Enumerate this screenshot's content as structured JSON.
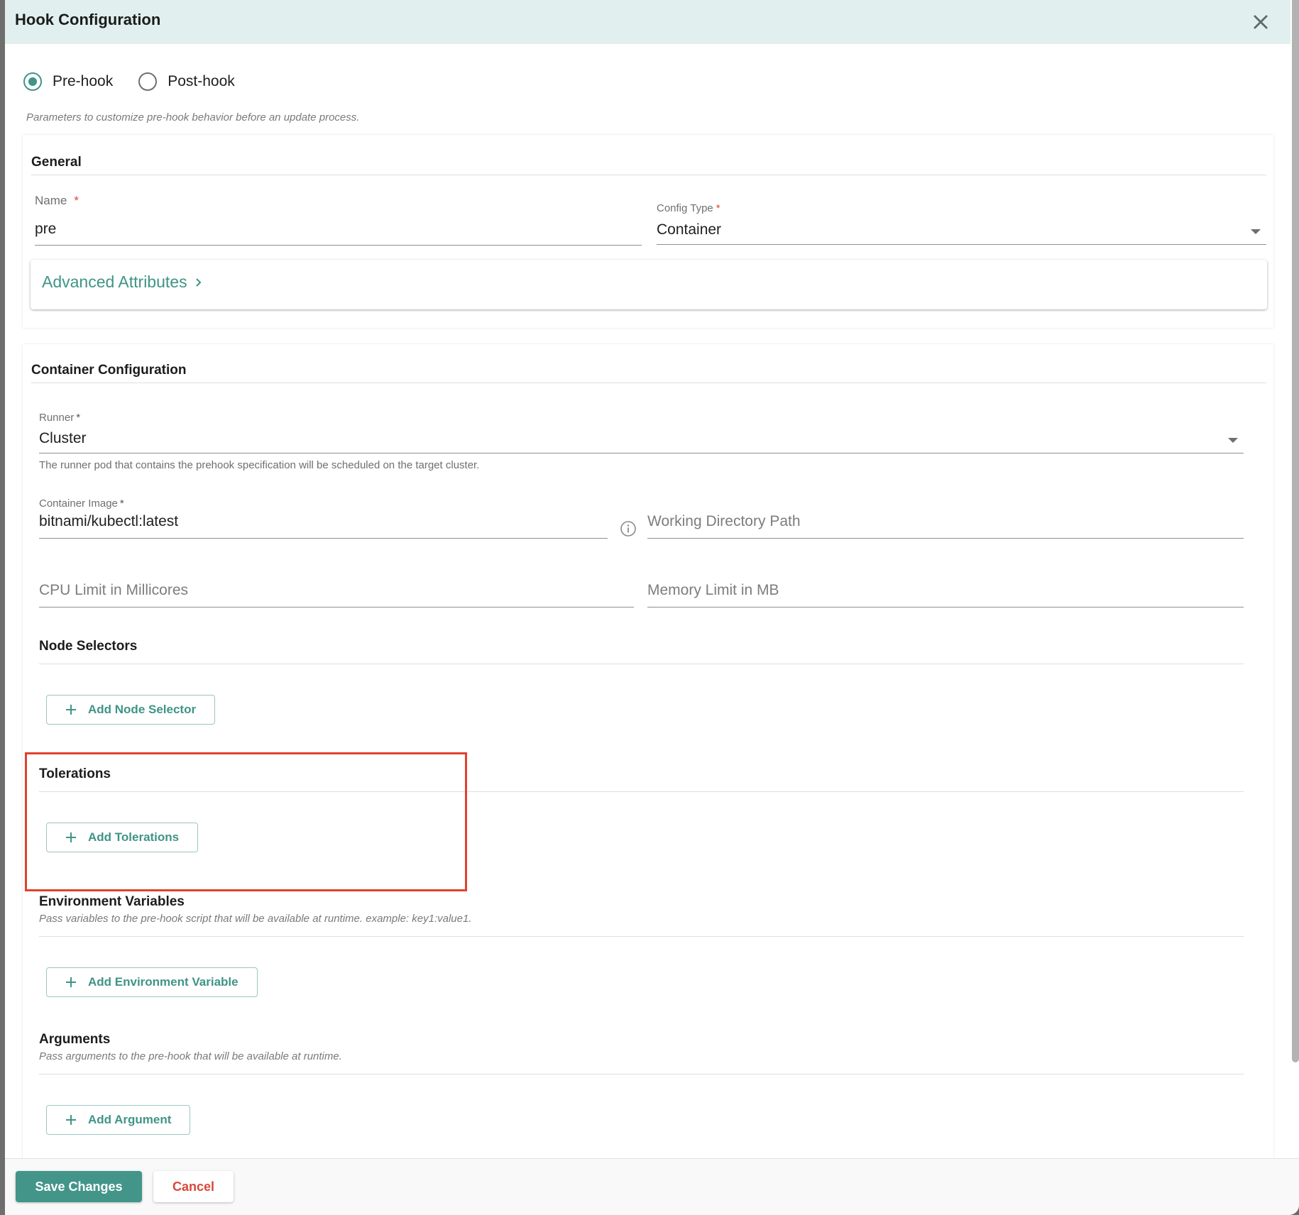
{
  "dialog": {
    "title": "Hook Configuration",
    "close_icon": "close-icon"
  },
  "hook_type": {
    "options": [
      {
        "label": "Pre-hook",
        "selected": true
      },
      {
        "label": "Post-hook",
        "selected": false
      }
    ],
    "description": "Parameters to customize pre-hook behavior before an update process."
  },
  "general": {
    "title": "General",
    "name": {
      "label": "Name",
      "required_mark": "*",
      "value": "pre"
    },
    "config_type": {
      "label": "Config Type",
      "required_mark": "*",
      "value": "Container"
    },
    "advanced_attributes": {
      "label": "Advanced Attributes",
      "icon": "chevron-right-icon"
    }
  },
  "container_configuration": {
    "title": "Container Configuration",
    "runner": {
      "label": "Runner",
      "required_mark": "*",
      "value": "Cluster",
      "helper": "The runner pod that contains the prehook specification will be scheduled on the target cluster."
    },
    "container_image": {
      "label": "Container Image",
      "required_mark": "*",
      "value": "bitnami/kubectl:latest",
      "info_icon": "info-icon"
    },
    "working_directory": {
      "placeholder": "Working Directory Path",
      "value": ""
    },
    "cpu_limit": {
      "placeholder": "CPU Limit in Millicores",
      "value": ""
    },
    "memory_limit": {
      "placeholder": "Memory Limit in MB",
      "value": ""
    },
    "node_selectors": {
      "title": "Node Selectors",
      "add_label": "Add Node Selector"
    },
    "tolerations": {
      "title": "Tolerations",
      "add_label": "Add Tolerations"
    },
    "environment_variables": {
      "title": "Environment Variables",
      "description": "Pass variables to the pre-hook script that will be available at runtime. example: key1:value1.",
      "add_label": "Add Environment Variable"
    },
    "arguments": {
      "title": "Arguments",
      "description": "Pass arguments to the pre-hook that will be available at runtime.",
      "add_label": "Add Argument"
    }
  },
  "footer": {
    "save_label": "Save Changes",
    "cancel_label": "Cancel"
  },
  "colors": {
    "accent": "#3f9487",
    "header_bg": "#e1f0ee",
    "danger": "#d9473a",
    "highlight_box": "#e0422e"
  }
}
